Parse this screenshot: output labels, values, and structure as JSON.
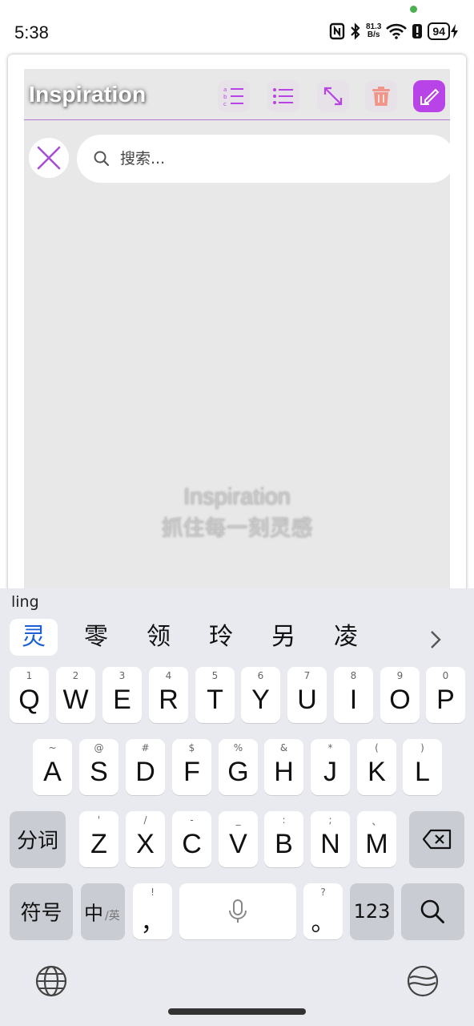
{
  "status_bar": {
    "time": "5:38",
    "net_speed_value": "81.3",
    "net_speed_unit": "B/s",
    "battery": "94"
  },
  "app": {
    "title": "Inspiration",
    "search": {
      "placeholder": "搜索..."
    },
    "empty_state": {
      "title": "Inspiration",
      "subtitle": "抓住每一刻灵感"
    },
    "accent_color": "#b843e6"
  },
  "keyboard": {
    "pinyin": "ling",
    "candidates": [
      "灵",
      "零",
      "领",
      "玲",
      "另",
      "凌"
    ],
    "row1": [
      {
        "hint": "1",
        "key": "Q"
      },
      {
        "hint": "2",
        "key": "W"
      },
      {
        "hint": "3",
        "key": "E"
      },
      {
        "hint": "4",
        "key": "R"
      },
      {
        "hint": "5",
        "key": "T"
      },
      {
        "hint": "6",
        "key": "Y"
      },
      {
        "hint": "7",
        "key": "U"
      },
      {
        "hint": "8",
        "key": "I"
      },
      {
        "hint": "9",
        "key": "O"
      },
      {
        "hint": "0",
        "key": "P"
      }
    ],
    "row2": [
      {
        "hint": "~",
        "key": "A"
      },
      {
        "hint": "@",
        "key": "S"
      },
      {
        "hint": "#",
        "key": "D"
      },
      {
        "hint": "$",
        "key": "F"
      },
      {
        "hint": "%",
        "key": "G"
      },
      {
        "hint": "&",
        "key": "H"
      },
      {
        "hint": "*",
        "key": "J"
      },
      {
        "hint": "(",
        "key": "K"
      },
      {
        "hint": ")",
        "key": "L"
      }
    ],
    "row3": [
      {
        "hint": "'",
        "key": "Z"
      },
      {
        "hint": "/",
        "key": "X"
      },
      {
        "hint": "-",
        "key": "C"
      },
      {
        "hint": "_",
        "key": "V"
      },
      {
        "hint": ":",
        "key": "B"
      },
      {
        "hint": ";",
        "key": "N"
      },
      {
        "hint": "、",
        "key": "M"
      }
    ],
    "segment_label": "分词",
    "symbols_label": "符号",
    "lang_main": "中",
    "lang_alt": "/英",
    "comma_hint": "!",
    "comma": "，",
    "period_hint": "?",
    "period": "。",
    "num_label": "123"
  }
}
